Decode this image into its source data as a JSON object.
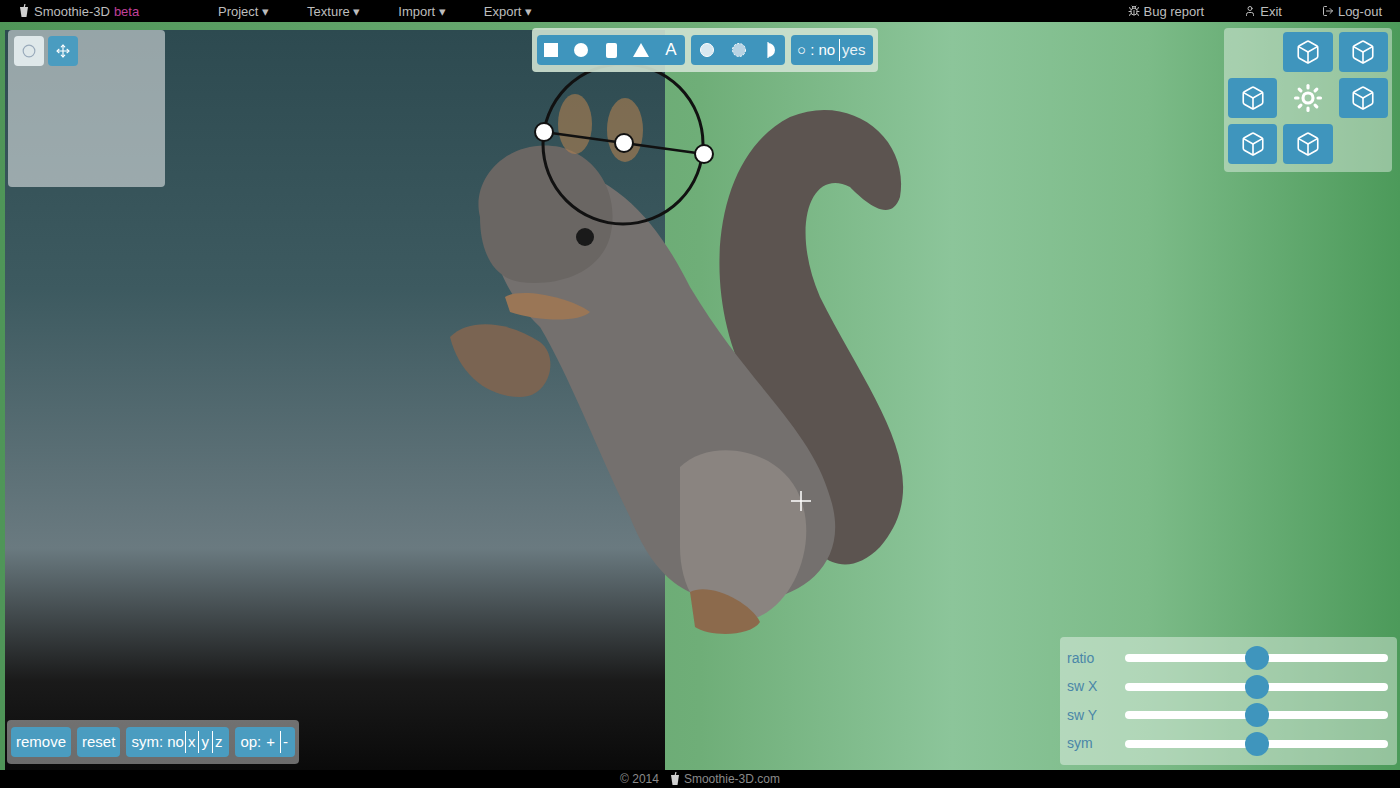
{
  "menu_bar": {
    "logo": "Smoothie-3D",
    "badge": "beta",
    "menus": [
      "Project ▾",
      "Texture ▾",
      "Import ▾",
      "Export ▾"
    ],
    "actions": [
      {
        "label": "Bug report",
        "kind": "bug"
      },
      {
        "label": "Exit",
        "kind": "exit"
      },
      {
        "label": "Log-out",
        "kind": "logout"
      }
    ]
  },
  "tool_panel": {
    "tools": [
      {
        "kind": "select",
        "selected": true
      },
      {
        "kind": "move",
        "selected": false
      }
    ]
  },
  "shape_toolbar": {
    "shapes": [
      {
        "kind": "box"
      },
      {
        "kind": "sphere"
      },
      {
        "kind": "cylinder"
      },
      {
        "kind": "cone"
      },
      {
        "kind": "text",
        "label": "A"
      }
    ],
    "modes": [
      {
        "kind": "smooth"
      },
      {
        "kind": "soft"
      },
      {
        "kind": "half"
      }
    ],
    "toggle": {
      "label": "○ :",
      "options": [
        {
          "label": "no",
          "selected": true
        },
        {
          "label": "yes",
          "selected": false
        }
      ]
    }
  },
  "view_panel": {
    "views": [
      {
        "kind": "cube"
      },
      {
        "kind": "cube"
      },
      {
        "kind": "cube"
      },
      {
        "kind": "light"
      },
      {
        "kind": "cube"
      },
      {
        "kind": "cube"
      },
      {
        "kind": "cube"
      }
    ]
  },
  "edit_bar": {
    "buttons": [
      "remove",
      "reset"
    ],
    "sym": {
      "label": "sym: no",
      "axes": [
        "x",
        "y",
        "z"
      ]
    },
    "op": {
      "label": "op:",
      "options": [
        "+",
        "-"
      ]
    }
  },
  "sliders": [
    {
      "label": "ratio",
      "level": 0.5
    },
    {
      "label": "sw X",
      "level": 0.5
    },
    {
      "label": "sw Y",
      "level": 0.5
    },
    {
      "label": "sym",
      "level": 0.5
    }
  ],
  "footer": {
    "copyright": "© 2014",
    "site": "Smoothie-3D.com"
  }
}
